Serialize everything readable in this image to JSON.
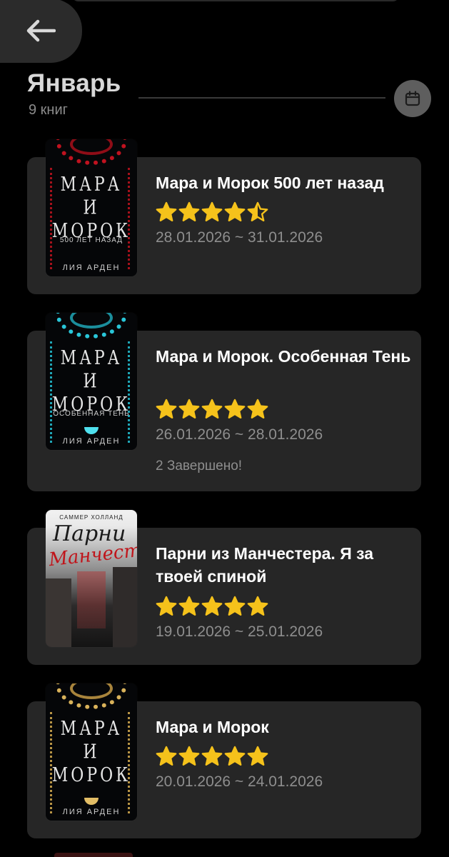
{
  "header": {
    "back_label": "back",
    "month": "Январь",
    "count": "9 книг"
  },
  "colors": {
    "background": "#000000",
    "card": "#262626",
    "star": "#F5C21B",
    "muted_text": "#8E8E8E"
  },
  "books": [
    {
      "title": "Мара и Морок 500 лет назад",
      "rating": 4.5,
      "dates": "28.01.2026 ~ 31.01.2026",
      "note": "",
      "cover": {
        "title_line1": "МАРА",
        "title_line2": "И",
        "title_line3": "МОРОК",
        "subtitle": "500 ЛЕТ НАЗАД",
        "author": "ЛИЯ АРДЕН",
        "accent": "#c0121f"
      }
    },
    {
      "title": "Мара и Морок. Особенная Тень",
      "rating": 5,
      "dates": "26.01.2026 ~ 28.01.2026",
      "note": "2 Завершено!",
      "cover": {
        "title_line1": "МАРА",
        "title_line2": "И",
        "title_line3": "МОРОК",
        "subtitle": "ОСОБЕННАЯ ТЕНЬ",
        "author": "ЛИЯ АРДЕН",
        "accent": "#29c6d8"
      }
    },
    {
      "title": "Парни из Манчестера. Я за твоей спиной",
      "rating": 5,
      "dates": "19.01.2026 ~ 25.01.2026",
      "note": "",
      "cover": {
        "author_top": "САММЕР ХОЛЛАНД",
        "script1": "Парни",
        "script2": "Манчестера"
      }
    },
    {
      "title": "Мара и Морок",
      "rating": 5,
      "dates": "20.01.2026 ~ 24.01.2026",
      "note": "",
      "cover": {
        "title_line1": "МАРА",
        "title_line2": "И",
        "title_line3": "МОРОК",
        "author": "ЛИЯ АРДЕН",
        "accent": "#d9b25a"
      }
    }
  ]
}
